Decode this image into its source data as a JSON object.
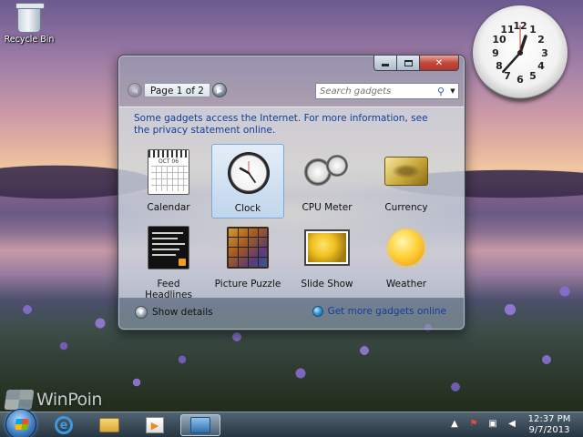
{
  "desktop": {
    "recycle_bin_label": "Recycle Bin",
    "watermark": "WinPoin",
    "clock_gadget": {
      "hour": 12,
      "minute": 37,
      "second": 0
    }
  },
  "window": {
    "toolbar": {
      "page_indicator": "Page 1 of 2",
      "search_placeholder": "Search gadgets"
    },
    "notice": {
      "text": "Some gadgets access the Internet.  For more information, ",
      "link": "see the privacy statement online."
    },
    "gadgets": [
      {
        "label": "Calendar",
        "icon": "calendar-icon",
        "selected": false
      },
      {
        "label": "Clock",
        "icon": "clock-icon",
        "selected": true
      },
      {
        "label": "CPU Meter",
        "icon": "cpu-meter-icon",
        "selected": false
      },
      {
        "label": "Currency",
        "icon": "currency-icon",
        "selected": false
      },
      {
        "label": "Feed Headlines",
        "icon": "feed-headlines-icon",
        "selected": false
      },
      {
        "label": "Picture Puzzle",
        "icon": "picture-puzzle-icon",
        "selected": false
      },
      {
        "label": "Slide Show",
        "icon": "slide-show-icon",
        "selected": false
      },
      {
        "label": "Weather",
        "icon": "weather-icon",
        "selected": false
      }
    ],
    "footer": {
      "show_details": "Show details",
      "get_more": "Get more gadgets online"
    }
  },
  "taskbar": {
    "time": "12:37 PM",
    "date": "9/7/2013"
  }
}
